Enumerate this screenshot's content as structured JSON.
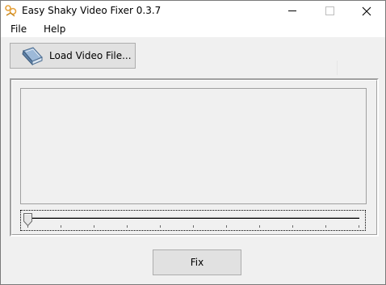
{
  "window": {
    "title": "Easy Shaky Video Fixer 0.3.7",
    "icon": "app-camera-icon"
  },
  "title_buttons": {
    "minimize": "minimize-icon",
    "maximize": "maximize-icon",
    "close": "close-icon"
  },
  "menu": {
    "items": [
      {
        "label": "File"
      },
      {
        "label": "Help"
      }
    ]
  },
  "toolbar": {
    "load_label": "Load Video File...",
    "load_icon": "book-icon"
  },
  "video": {
    "position": 0,
    "tick_count": 11
  },
  "actions": {
    "fix_label": "Fix"
  },
  "colors": {
    "window_bg": "#f0f0f0",
    "titlebar_bg": "#ffffff",
    "button_bg": "#e1e1e1",
    "button_border": "#adadad",
    "icon_orange": "#e6a23c"
  }
}
